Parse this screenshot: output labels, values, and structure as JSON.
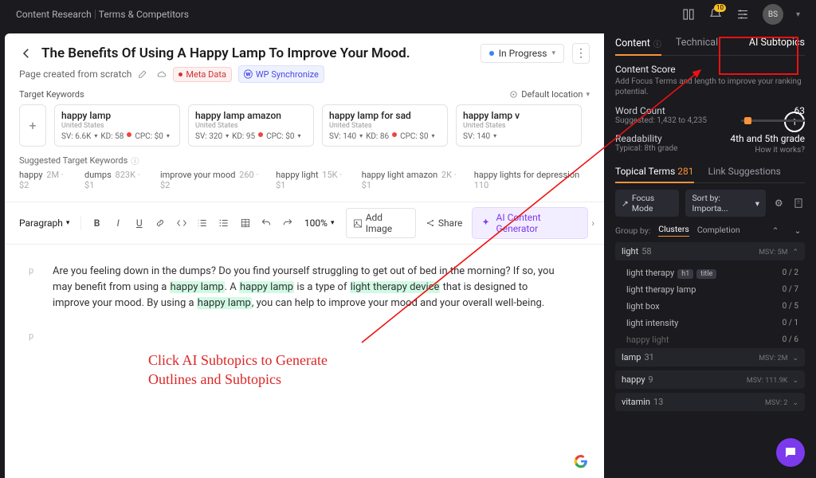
{
  "breadcrumb": {
    "a": "Content Research",
    "b": "Terms & Competitors"
  },
  "topbar": {
    "notif_count": "10",
    "avatar": "BS"
  },
  "page": {
    "title": "The Benefits Of Using A Happy Lamp To Improve Your Mood.",
    "subtitle": "Page created from scratch",
    "status": "In Progress",
    "meta_data": "Meta Data",
    "wp_sync": "WP Synchronize",
    "target_kw_label": "Target Keywords",
    "default_loc": "Default location",
    "suggested_label": "Suggested Target Keywords"
  },
  "keywords": [
    {
      "name": "happy lamp",
      "loc": "United States",
      "sv": "6.6K",
      "kd": "58",
      "kd_color": "#ef4444",
      "cpc": "$0"
    },
    {
      "name": "happy lamp amazon",
      "loc": "United States",
      "sv": "320",
      "kd": "95",
      "kd_color": "#ef4444",
      "cpc": "$0"
    },
    {
      "name": "happy lamp for sad",
      "loc": "United States",
      "sv": "140",
      "kd": "86",
      "kd_color": "#ef4444",
      "cpc": "$0"
    },
    {
      "name": "happy lamp v",
      "loc": "United States",
      "sv": "140",
      "kd": "",
      "kd_color": "",
      "cpc": ""
    }
  ],
  "suggested": [
    {
      "t": "happy",
      "m": "2M · $2"
    },
    {
      "t": "dumps",
      "m": "823K · $1"
    },
    {
      "t": "improve your mood",
      "m": "260 · $2"
    },
    {
      "t": "happy light",
      "m": "15K · $1"
    },
    {
      "t": "happy light amazon",
      "m": "2K · $1"
    },
    {
      "t": "happy lights for depression",
      "m": "110"
    }
  ],
  "toolbar": {
    "paragraph": "Paragraph",
    "zoom": "100%",
    "add_image": "Add Image",
    "share": "Share",
    "ai_gen": "AI Content Generator"
  },
  "doc": {
    "p1a": "Are you feeling down in the dumps? Do you find yourself struggling to get out of bed in the morning? If so, you may benefit from using a ",
    "hl1": "happy lamp",
    "p1b": ". A ",
    "hl2": "happy lamp",
    "p1c": " is a type of ",
    "hl3": "light therapy device",
    "p1d": " that is designed to improve your mood. By using a ",
    "hl4": "happy lamp",
    "p1e": ", you can help to improve your mood and your overall well-being."
  },
  "annotation": {
    "l1": "Click AI Subtopics to Generate",
    "l2": "Outlines and Subtopics"
  },
  "side": {
    "tabs": {
      "content": "Content",
      "technical": "Technical",
      "ai": "AI Subtopics"
    },
    "cs_label": "Content Score",
    "cs_sub": "Add Focus Terms and length to improve your ranking potential.",
    "score": "1",
    "wc_label": "Word Count",
    "wc_val": "63",
    "wc_sub": "Suggested: 1,432 to 4,235",
    "rd_label": "Readability",
    "rd_val": "4th and 5th grade",
    "rd_sub": "Typical: 8th grade",
    "how": "How it works?",
    "subtabs": {
      "tt": "Topical Terms",
      "tt_cnt": "281",
      "ls": "Link Suggestions"
    },
    "focus_mode": "Focus Mode",
    "sort_by": "Sort by: Importa...",
    "group_by_label": "Group by:",
    "group_clusters": "Clusters",
    "group_completion": "Completion",
    "terms": [
      {
        "name": "light",
        "cnt": "58",
        "msv": "MSV: 5M",
        "open": true,
        "children": [
          {
            "name": "light therapy",
            "tags": [
              "h1",
              "title"
            ],
            "prog": "0 / 2"
          },
          {
            "name": "light therapy lamp",
            "prog": "0 / 7"
          },
          {
            "name": "light box",
            "prog": "0 / 5"
          },
          {
            "name": "light intensity",
            "prog": "0 / 1"
          },
          {
            "name": "happy light",
            "prog": "0 / 6",
            "dim": true
          }
        ]
      },
      {
        "name": "lamp",
        "cnt": "31",
        "msv": "MSV: 2M"
      },
      {
        "name": "happy",
        "cnt": "9",
        "msv": "MSV: 111.9K"
      },
      {
        "name": "vitamin",
        "cnt": "13",
        "msv": "MSV: 2"
      }
    ]
  }
}
